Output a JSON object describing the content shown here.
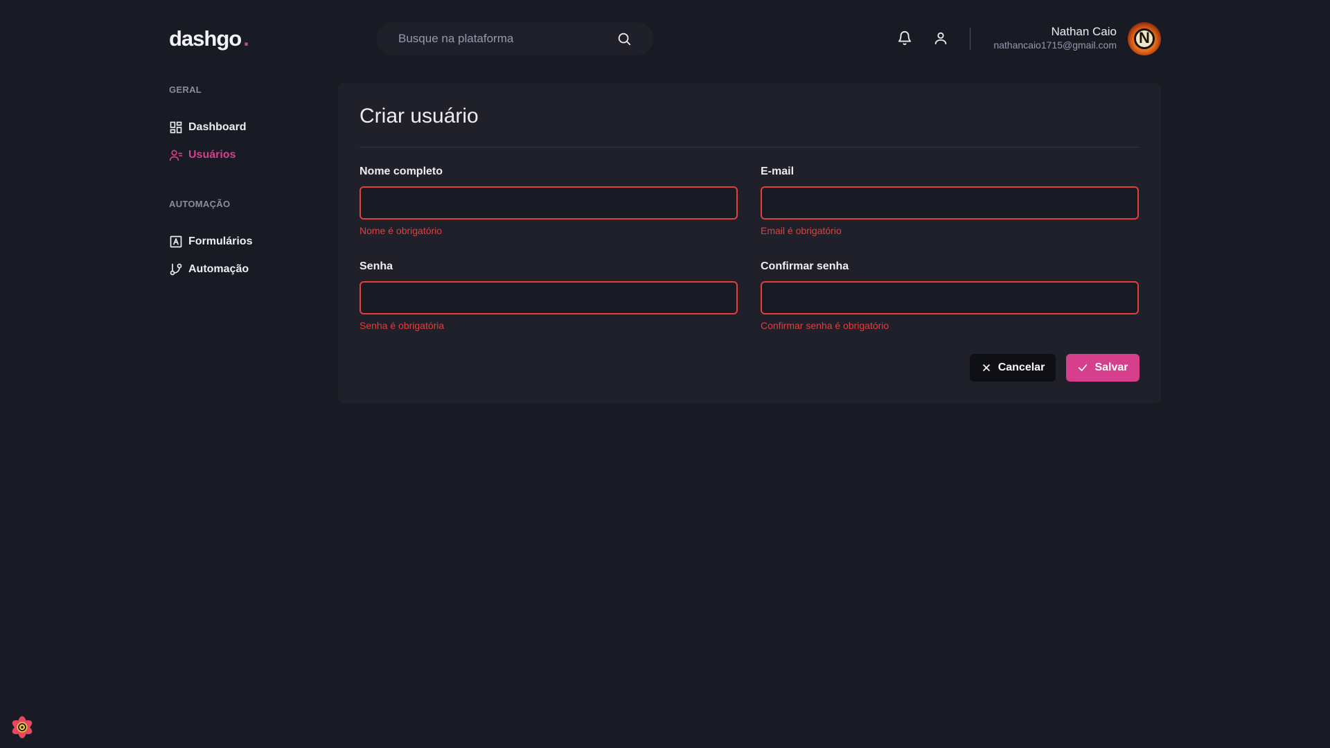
{
  "brand": {
    "name": "dashgo",
    "dot": ".",
    "accent_color": "#d53f8c"
  },
  "search": {
    "placeholder": "Busque na plataforma",
    "value": ""
  },
  "header_icons": [
    "bell-icon",
    "user-icon"
  ],
  "profile": {
    "name": "Nathan Caio",
    "email": "nathancaio1715@gmail.com",
    "avatar_letter": "N"
  },
  "sidebar": {
    "sections": [
      {
        "title": "GERAL",
        "items": [
          {
            "label": "Dashboard",
            "icon": "dashboard-icon",
            "active": false
          },
          {
            "label": "Usuários",
            "icon": "users-icon",
            "active": true
          }
        ]
      },
      {
        "title": "AUTOMAÇÃO",
        "items": [
          {
            "label": "Formulários",
            "icon": "form-icon",
            "active": false
          },
          {
            "label": "Automação",
            "icon": "git-branch-icon",
            "active": false
          }
        ]
      }
    ]
  },
  "form": {
    "title": "Criar usuário",
    "fields": [
      {
        "label": "Nome completo",
        "value": "",
        "error": "Nome é obrigatório"
      },
      {
        "label": "E-mail",
        "value": "",
        "error": "Email é obrigatório"
      },
      {
        "label": "Senha",
        "value": "",
        "error": "Senha é obrigatória"
      },
      {
        "label": "Confirmar senha",
        "value": "",
        "error": "Confirmar senha é obrigatório"
      }
    ],
    "cancel_label": "Cancelar",
    "save_label": "Salvar",
    "error_color": "#e53e3e"
  }
}
